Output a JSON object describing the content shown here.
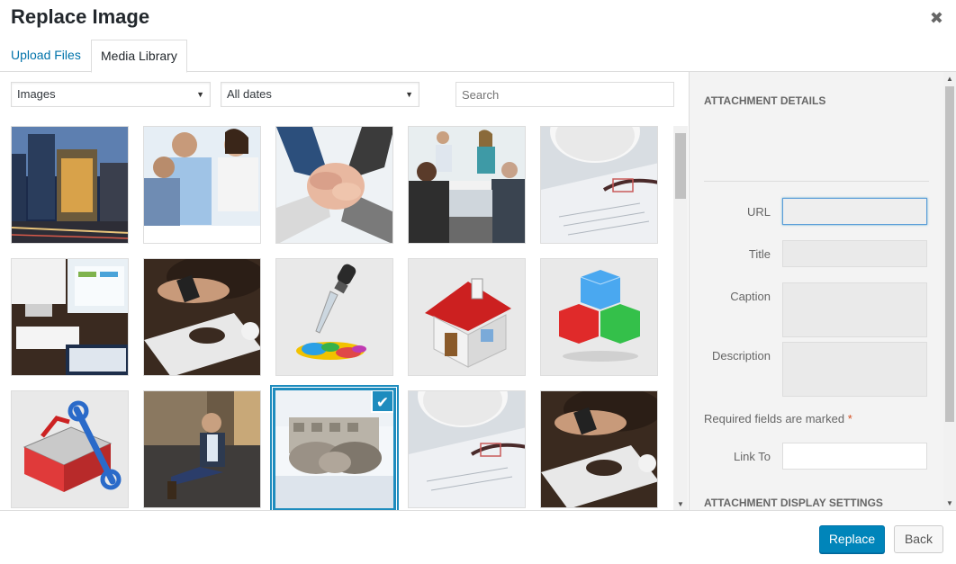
{
  "header": {
    "title": "Replace Image",
    "close_glyph": "✖"
  },
  "tabs": [
    {
      "label": "Upload Files",
      "active": false
    },
    {
      "label": "Media Library",
      "active": true
    }
  ],
  "toolbar": {
    "type_filter": "Images",
    "date_filter": "All dates",
    "search_placeholder": "Search",
    "dropdown_glyph": "▼"
  },
  "media_items": [
    {
      "icon": "city-night-photo",
      "selected": false
    },
    {
      "icon": "business-meeting-photo",
      "selected": false
    },
    {
      "icon": "team-hands-photo",
      "selected": false
    },
    {
      "icon": "office-meeting-photo",
      "selected": false
    },
    {
      "icon": "coffee-document-photo",
      "selected": false
    },
    {
      "icon": "computer-desk-photo",
      "selected": false
    },
    {
      "icon": "phone-desk-photo",
      "selected": false
    },
    {
      "icon": "paint-dropper-icon",
      "selected": false
    },
    {
      "icon": "house-icon",
      "selected": false
    },
    {
      "icon": "cubes-icon",
      "selected": false
    },
    {
      "icon": "toolbox-icon",
      "selected": false
    },
    {
      "icon": "man-on-couch-photo",
      "selected": false
    },
    {
      "icon": "handshake-photo",
      "selected": true
    },
    {
      "icon": "coffee-document-photo",
      "selected": false
    },
    {
      "icon": "phone-desk-photo",
      "selected": false
    }
  ],
  "check_glyph": "✔",
  "sidebar": {
    "details_heading": "ATTACHMENT DETAILS",
    "url_label": "URL",
    "title_label": "Title",
    "caption_label": "Caption",
    "description_label": "Description",
    "required_text": "Required fields are marked",
    "required_star": "*",
    "link_to_label": "Link To",
    "display_heading": "ATTACHMENT DISPLAY SETTINGS"
  },
  "scroll_glyphs": {
    "up": "▲",
    "down": "▼"
  },
  "footer": {
    "replace_label": "Replace",
    "back_label": "Back"
  },
  "colors": {
    "accent": "#0085ba",
    "selected_border": "#1e8cbe",
    "link": "#0073aa"
  }
}
